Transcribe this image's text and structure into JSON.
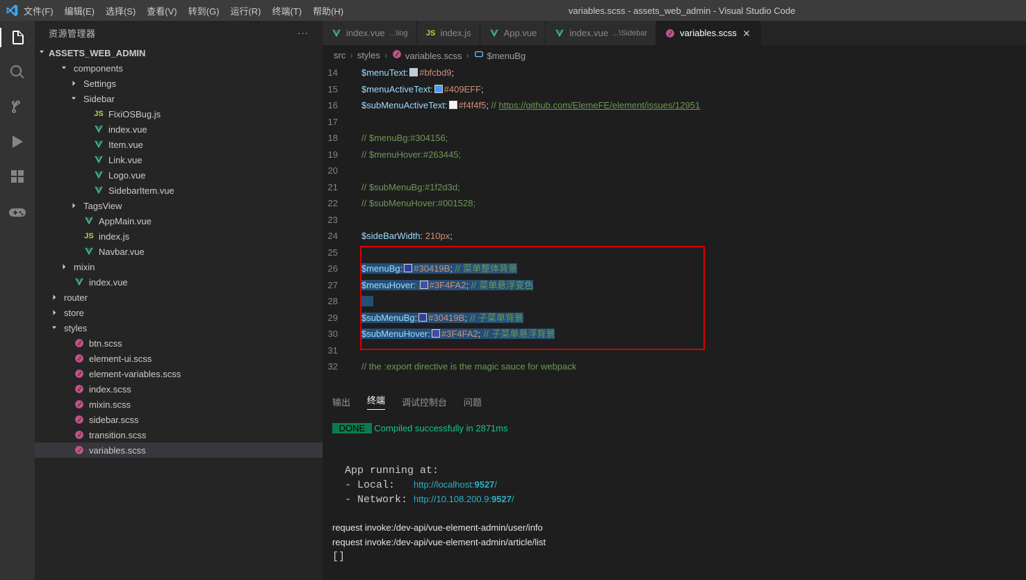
{
  "titlebar": {
    "menus": [
      "文件(F)",
      "编辑(E)",
      "选择(S)",
      "查看(V)",
      "转到(G)",
      "运行(R)",
      "终端(T)",
      "帮助(H)"
    ],
    "title": "variables.scss - assets_web_admin - Visual Studio Code"
  },
  "sidebar": {
    "title": "资源管理器",
    "section": "ASSETS_WEB_ADMIN",
    "tree": [
      {
        "kind": "folder",
        "open": true,
        "depth": 1,
        "label": "components"
      },
      {
        "kind": "folder",
        "open": false,
        "depth": 2,
        "label": "Settings"
      },
      {
        "kind": "folder",
        "open": true,
        "depth": 2,
        "label": "Sidebar"
      },
      {
        "kind": "file",
        "ic": "js",
        "depth": 3,
        "label": "FixiOSBug.js"
      },
      {
        "kind": "file",
        "ic": "vue",
        "depth": 3,
        "label": "index.vue"
      },
      {
        "kind": "file",
        "ic": "vue",
        "depth": 3,
        "label": "Item.vue"
      },
      {
        "kind": "file",
        "ic": "vue",
        "depth": 3,
        "label": "Link.vue"
      },
      {
        "kind": "file",
        "ic": "vue",
        "depth": 3,
        "label": "Logo.vue"
      },
      {
        "kind": "file",
        "ic": "vue",
        "depth": 3,
        "label": "SidebarItem.vue"
      },
      {
        "kind": "folder",
        "open": false,
        "depth": 2,
        "label": "TagsView"
      },
      {
        "kind": "file",
        "ic": "vue",
        "depth": 2,
        "label": "AppMain.vue"
      },
      {
        "kind": "file",
        "ic": "js",
        "depth": 2,
        "label": "index.js"
      },
      {
        "kind": "file",
        "ic": "vue",
        "depth": 2,
        "label": "Navbar.vue"
      },
      {
        "kind": "folder",
        "open": false,
        "depth": 1,
        "label": "mixin"
      },
      {
        "kind": "file",
        "ic": "vue",
        "depth": 1,
        "label": "index.vue"
      },
      {
        "kind": "folder",
        "open": false,
        "depth": 0,
        "label": "router"
      },
      {
        "kind": "folder",
        "open": false,
        "depth": 0,
        "label": "store"
      },
      {
        "kind": "folder",
        "open": true,
        "depth": 0,
        "label": "styles"
      },
      {
        "kind": "file",
        "ic": "scss",
        "depth": 1,
        "label": "btn.scss"
      },
      {
        "kind": "file",
        "ic": "scss",
        "depth": 1,
        "label": "element-ui.scss"
      },
      {
        "kind": "file",
        "ic": "scss",
        "depth": 1,
        "label": "element-variables.scss"
      },
      {
        "kind": "file",
        "ic": "scss",
        "depth": 1,
        "label": "index.scss"
      },
      {
        "kind": "file",
        "ic": "scss",
        "depth": 1,
        "label": "mixin.scss"
      },
      {
        "kind": "file",
        "ic": "scss",
        "depth": 1,
        "label": "sidebar.scss"
      },
      {
        "kind": "file",
        "ic": "scss",
        "depth": 1,
        "label": "transition.scss"
      },
      {
        "kind": "file",
        "ic": "scss",
        "depth": 1,
        "label": "variables.scss",
        "active": true
      }
    ]
  },
  "tabs": [
    {
      "ic": "vue",
      "label": "index.vue",
      "sub": "...\\log"
    },
    {
      "ic": "js",
      "label": "index.js"
    },
    {
      "ic": "vue",
      "label": "App.vue"
    },
    {
      "ic": "vue",
      "label": "index.vue",
      "sub": "...\\Sidebar"
    },
    {
      "ic": "scss",
      "label": "variables.scss",
      "active": true,
      "close": true
    }
  ],
  "breadcrumb": {
    "items": [
      "src",
      "styles",
      "variables.scss",
      "$menuBg"
    ]
  },
  "lines": [
    {
      "n": 14,
      "seg": [
        [
          "var",
          "$menuText"
        ],
        [
          "punc",
          ":"
        ],
        [
          "swatch",
          "#bfcbd9"
        ],
        [
          "str",
          "#bfcbd9"
        ],
        [
          "punc",
          ";"
        ]
      ]
    },
    {
      "n": 15,
      "seg": [
        [
          "var",
          "$menuActiveText"
        ],
        [
          "punc",
          ":"
        ],
        [
          "swatch",
          "#409EFF"
        ],
        [
          "str",
          "#409EFF"
        ],
        [
          "punc",
          ";"
        ]
      ]
    },
    {
      "n": 16,
      "seg": [
        [
          "var",
          "$subMenuActiveText"
        ],
        [
          "punc",
          ":"
        ],
        [
          "swatch",
          "#f4f4f5"
        ],
        [
          "str",
          "#f4f4f5"
        ],
        [
          "punc",
          ";"
        ],
        [
          "punc",
          " "
        ],
        [
          "com",
          "// "
        ],
        [
          "link",
          "https://github.com/ElemeFE/element/issues/12951"
        ]
      ]
    },
    {
      "n": 17,
      "seg": []
    },
    {
      "n": 18,
      "seg": [
        [
          "com",
          "// $menuBg:#304156;"
        ]
      ]
    },
    {
      "n": 19,
      "seg": [
        [
          "com",
          "// $menuHover:#263445;"
        ]
      ]
    },
    {
      "n": 20,
      "seg": []
    },
    {
      "n": 21,
      "seg": [
        [
          "com",
          "// $subMenuBg:#1f2d3d;"
        ]
      ]
    },
    {
      "n": 22,
      "seg": [
        [
          "com",
          "// $subMenuHover:#001528;"
        ]
      ]
    },
    {
      "n": 23,
      "seg": []
    },
    {
      "n": 24,
      "seg": [
        [
          "var",
          "$sideBarWidth"
        ],
        [
          "punc",
          ": "
        ],
        [
          "num",
          "210px"
        ],
        [
          "punc",
          ";"
        ]
      ]
    },
    {
      "n": 25,
      "seg": []
    },
    {
      "n": 26,
      "hl": true,
      "seg": [
        [
          "var",
          "$menuBg"
        ],
        [
          "punc",
          ":"
        ],
        [
          "swatch",
          "#30419B"
        ],
        [
          "str",
          "#30419B"
        ],
        [
          "punc",
          ";"
        ],
        [
          "wspace",
          " "
        ],
        [
          "com",
          "//"
        ],
        [
          "wspace",
          "·"
        ],
        [
          "com",
          "菜单整体背景"
        ]
      ]
    },
    {
      "n": 27,
      "hl": true,
      "seg": [
        [
          "var",
          "$menuHover"
        ],
        [
          "punc",
          ": "
        ],
        [
          "swatch",
          "#3F4FA2"
        ],
        [
          "str",
          "#3F4FA2"
        ],
        [
          "punc",
          ";"
        ],
        [
          "wspace",
          " "
        ],
        [
          "com",
          "//"
        ],
        [
          "wspace",
          "·"
        ],
        [
          "com",
          "菜单悬浮变色"
        ]
      ]
    },
    {
      "n": 28,
      "hl": true,
      "seg": [
        [
          "wspace",
          "····"
        ]
      ]
    },
    {
      "n": 29,
      "hl": true,
      "seg": [
        [
          "var",
          "$subMenuBg"
        ],
        [
          "punc",
          ":"
        ],
        [
          "swatch",
          "#30419B"
        ],
        [
          "str",
          "#30419B"
        ],
        [
          "punc",
          ";"
        ],
        [
          "wspace",
          "·"
        ],
        [
          "com",
          "//"
        ],
        [
          "wspace",
          "·"
        ],
        [
          "com",
          "子菜单背景"
        ]
      ]
    },
    {
      "n": 30,
      "hl": true,
      "seg": [
        [
          "var",
          "$subMenuHover"
        ],
        [
          "punc",
          ":"
        ],
        [
          "swatch",
          "#3F4FA2"
        ],
        [
          "str",
          "#3F4FA2"
        ],
        [
          "punc",
          ";"
        ],
        [
          "wspace",
          "·"
        ],
        [
          "com",
          "//"
        ],
        [
          "wspace",
          "·"
        ],
        [
          "com",
          "子菜单悬浮背景"
        ]
      ]
    },
    {
      "n": 31,
      "seg": []
    },
    {
      "n": 32,
      "seg": [
        [
          "com",
          "// the :export directive is the magic sauce for webpack"
        ]
      ]
    }
  ],
  "panel": {
    "tabs": [
      "输出",
      "终端",
      "调试控制台",
      "问题"
    ],
    "active": 1,
    "done": " DONE ",
    "compiled": " Compiled successfully in 2871ms",
    "run": "  App running at:",
    "local_l": "  - Local:   ",
    "local_u": "http://localhost:",
    "local_p": "9527",
    "local_s": "/",
    "net_l": "  - Network: ",
    "net_u": "http://10.108.200.9:",
    "net_p": "9527",
    "net_s": "/",
    "req1": "request invoke:/dev-api/vue-element-admin/user/info",
    "req2": "request invoke:/dev-api/vue-element-admin/article/list",
    "cursor": "[]"
  }
}
